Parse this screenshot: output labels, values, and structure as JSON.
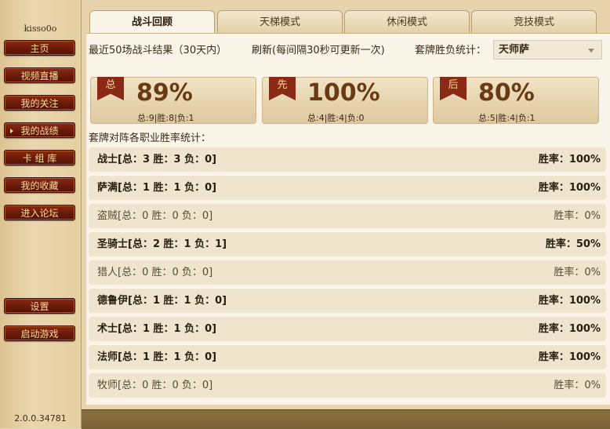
{
  "sidebar": {
    "username": "kisso0o",
    "nav": [
      {
        "label": "主页"
      },
      {
        "label": "视频直播"
      },
      {
        "label": "我的关注"
      },
      {
        "label": "我的战绩"
      },
      {
        "label": "卡 组 库"
      },
      {
        "label": "我的收藏"
      },
      {
        "label": "进入论坛"
      }
    ],
    "settings_label": "设置",
    "launch_label": "启动游戏",
    "version": "2.0.0.34781"
  },
  "tabs": [
    {
      "label": "战斗回顾",
      "active": true
    },
    {
      "label": "天梯模式",
      "active": false
    },
    {
      "label": "休闲模式",
      "active": false
    },
    {
      "label": "竞技模式",
      "active": false
    }
  ],
  "info": {
    "recent": "最近50场战斗结果（30天内）",
    "refresh_link": "刷新",
    "refresh_note": "(每间隔30秒可更新一次)",
    "deck_label": "套牌胜负统计：",
    "deck_selected": "天师萨"
  },
  "stats": [
    {
      "flag": "总",
      "pct": "89%",
      "detail": "总:9|胜:8|负:1"
    },
    {
      "flag": "先",
      "pct": "100%",
      "detail": "总:4|胜:4|负:0"
    },
    {
      "flag": "后",
      "pct": "80%",
      "detail": "总:5|胜:4|负:1"
    }
  ],
  "section_title": "套牌对阵各职业胜率统计：",
  "classes": [
    {
      "label": "战士[总：3 胜：3 负：0]",
      "rate": "胜率：100%",
      "bold": true
    },
    {
      "label": "萨满[总：1 胜：1 负：0]",
      "rate": "胜率：100%",
      "bold": true
    },
    {
      "label": "盗贼[总：0 胜：0 负：0]",
      "rate": "胜率：0%",
      "bold": false
    },
    {
      "label": "圣骑士[总：2 胜：1 负：1]",
      "rate": "胜率：50%",
      "bold": true
    },
    {
      "label": "猎人[总：0 胜：0 负：0]",
      "rate": "胜率：0%",
      "bold": false
    },
    {
      "label": "德鲁伊[总：1 胜：1 负：0]",
      "rate": "胜率：100%",
      "bold": true
    },
    {
      "label": "术士[总：1 胜：1 负：0]",
      "rate": "胜率：100%",
      "bold": true
    },
    {
      "label": "法师[总：1 胜：1 负：0]",
      "rate": "胜率：100%",
      "bold": true
    },
    {
      "label": "牧师[总：0 胜：0 负：0]",
      "rate": "胜率：0%",
      "bold": false
    }
  ]
}
